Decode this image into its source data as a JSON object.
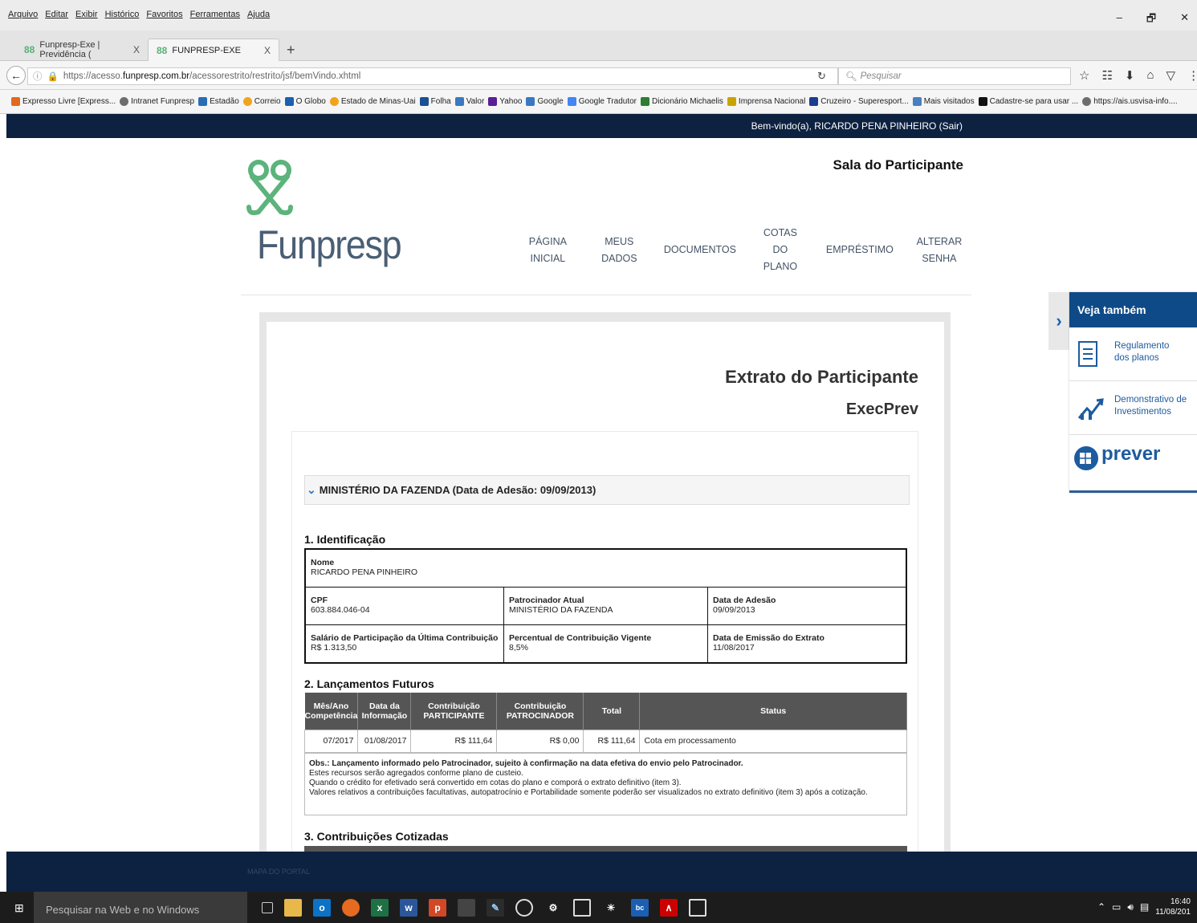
{
  "menubar": {
    "items": [
      "Arquivo",
      "Editar",
      "Exibir",
      "Histórico",
      "Favoritos",
      "Ferramentas",
      "Ajuda"
    ],
    "controls": [
      "–",
      "🗗",
      "✕"
    ]
  },
  "tabs": [
    {
      "label": "Funpresp-Exe | Previdência (",
      "close": "X"
    },
    {
      "label": "FUNPRESP-EXE",
      "close": "X"
    }
  ],
  "newtab": "+",
  "url": {
    "prefix": "https://acesso.",
    "domain": "funpresp.com.br",
    "path": "/acessorestrito/restrito/jsf/bemVindo.xhtml"
  },
  "search_placeholder": "Pesquisar",
  "bookmarks": [
    {
      "label": "Expresso Livre [Express...",
      "color": "#e06a1f"
    },
    {
      "label": "Intranet Funpresp",
      "color": "#6d6d6d"
    },
    {
      "label": "Estadão",
      "color": "#2a6db5"
    },
    {
      "label": "Correio",
      "color": "#f2a31c"
    },
    {
      "label": "O Globo",
      "color": "#1d5fb0"
    },
    {
      "label": "Estado de Minas-Uai",
      "color": "#f2a31c"
    },
    {
      "label": "Folha",
      "color": "#1b4f92"
    },
    {
      "label": "Valor",
      "color": "#3a79c0"
    },
    {
      "label": "Yahoo",
      "color": "#5b1e96"
    },
    {
      "label": "Google",
      "color": "#3a79c0"
    },
    {
      "label": "Google Tradutor",
      "color": "#4285f4"
    },
    {
      "label": "Dicionário Michaelis",
      "color": "#2e7d32"
    },
    {
      "label": "Imprensa Nacional",
      "color": "#c9a400"
    },
    {
      "label": "Cruzeiro - Superesport...",
      "color": "#1b3d8f"
    },
    {
      "label": "Mais visitados",
      "color": "#4a7fc1"
    },
    {
      "label": "Cadastre-se para usar ...",
      "color": "#111111"
    },
    {
      "label": "https://ais.usvisa-info....",
      "color": "#6d6d6d"
    }
  ],
  "welcome": "Bem-vindo(a), RICARDO PENA PINHEIRO (Sair)",
  "logo_text": "Funpresp",
  "sala": "Sala do Participante",
  "nav": [
    "PÁGINA INICIAL",
    "MEUS DADOS",
    "DOCUMENTOS",
    "COTAS DO",
    "PLANO",
    "EMPRÉSTIMO",
    "ALTERAR SENHA"
  ],
  "veja": {
    "title": "Veja também",
    "items": [
      {
        "line1": "Regulamento",
        "line2": "dos planos"
      },
      {
        "line1": "Demonstrativo de",
        "line2": "Investimentos"
      }
    ],
    "prever": "prever"
  },
  "extrato": {
    "title": "Extrato do Participante",
    "subtitle": "ExecPrev"
  },
  "accordion": "MINISTÉRIO DA FAZENDA (Data de Adesão: 09/09/2013)",
  "sec1": "1. Identificação",
  "ident": {
    "nome_l": "Nome",
    "nome_v": "RICARDO PENA PINHEIRO",
    "cpf_l": "CPF",
    "cpf_v": "603.884.046-04",
    "patro_l": "Patrocinador Atual",
    "patro_v": "MINISTÉRIO DA FAZENDA",
    "adesao_l": "Data de Adesão",
    "adesao_v": "09/09/2013",
    "sal_l": "Salário de Participação da Última Contribuição",
    "sal_v": "R$ 1.313,50",
    "perc_l": "Percentual de Contribuição Vigente",
    "perc_v": "8,5%",
    "emis_l": "Data de Emissão do Extrato",
    "emis_v": "11/08/2017"
  },
  "sec2": "2. Lançamentos Futuros",
  "lf_headers": [
    "Mês/Ano",
    "Competência",
    "Data da",
    "Informação",
    "Contribuição",
    "PARTICIPANTE",
    "Contribuição",
    "PATROCINADOR",
    "Total",
    "Status"
  ],
  "lf_row": [
    "07/2017",
    "01/08/2017",
    "R$ 111,64",
    "R$ 0,00",
    "R$ 111,64",
    "Cota em processamento"
  ],
  "obs": {
    "bold": "Obs.: Lançamento informado pelo Patrocinador, sujeito à confirmação na data efetiva do envio pelo Patrocinador.",
    "l1": "Estes recursos serão agregados conforme plano de custeio.",
    "l2": "Quando o crédito for efetivado será convertido em cotas do plano e comporá o extrato definitivo (item 3).",
    "l3": "Valores relativos a contribuições facultativas, autopatrocínio e Portabilidade somente poderão ser visualizados no extrato definitivo (item 3) após a cotização."
  },
  "sec3": "3. Contribuições Cotizadas",
  "footer": "MAPA DO PORTAL",
  "taskbar": {
    "search": "Pesquisar na Web e no Windows",
    "time": "16:40",
    "date": "11/08/201"
  }
}
